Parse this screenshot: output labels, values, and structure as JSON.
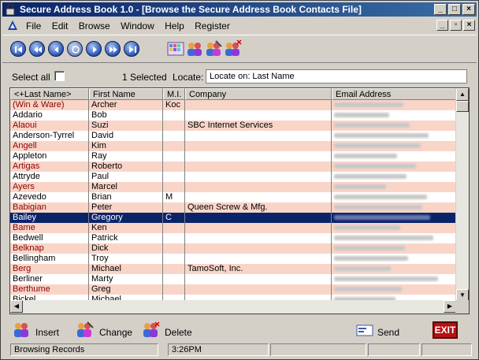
{
  "window": {
    "title": "Secure Address Book 1.0 - [Browse the Secure Address Book Contacts File]",
    "controls": [
      "_",
      "□",
      "×"
    ],
    "mdi_controls": [
      "_",
      "▫",
      "×"
    ]
  },
  "menu": {
    "items": [
      "File",
      "Edit",
      "Browse",
      "Window",
      "Help",
      "Register"
    ]
  },
  "toolbar": {
    "nav_buttons": [
      "first",
      "prev-page",
      "prev",
      "refresh",
      "next",
      "next-page",
      "last"
    ],
    "action_icons": [
      "mosaic-icon",
      "contacts-icon",
      "contacts-edit-icon",
      "contacts-delete-icon"
    ]
  },
  "filter": {
    "select_all_label": "Select all",
    "selected_count": "1 Selected",
    "locate_label": "Locate:",
    "locate_value": "Locate on: Last Name"
  },
  "grid": {
    "columns": [
      "<+Last Name>",
      "First Name",
      "M.I.",
      "Company",
      "Email Address"
    ],
    "rows": [
      {
        "last": "(Win & Ware)",
        "first": "Archer",
        "mi": "Koc",
        "company": "",
        "email_len": 88
      },
      {
        "last": "Addario",
        "first": "Bob",
        "mi": "",
        "company": "",
        "email_len": 70
      },
      {
        "last": "Alaoui",
        "first": "Suzi",
        "mi": "",
        "company": "SBC Internet Services",
        "email_len": 96
      },
      {
        "last": "Anderson-Tyrrel",
        "first": "David",
        "mi": "",
        "company": "",
        "email_len": 120
      },
      {
        "last": "Angell",
        "first": "Kim",
        "mi": "",
        "company": "",
        "email_len": 110
      },
      {
        "last": "Appleton",
        "first": "Ray",
        "mi": "",
        "company": "",
        "email_len": 80
      },
      {
        "last": "Artigas",
        "first": "Roberto",
        "mi": "",
        "company": "",
        "email_len": 104
      },
      {
        "last": "Attryde",
        "first": "Paul",
        "mi": "",
        "company": "",
        "email_len": 92
      },
      {
        "last": "Ayers",
        "first": "Marcel",
        "mi": "",
        "company": "",
        "email_len": 66
      },
      {
        "last": "Azevedo",
        "first": "Brian",
        "mi": "M",
        "company": "",
        "email_len": 118
      },
      {
        "last": "Babigian",
        "first": "Peter",
        "mi": "",
        "company": "Queen Screw & Mfg.",
        "email_len": 112
      },
      {
        "last": "Bailey",
        "first": "Gregory",
        "mi": "C",
        "company": "",
        "email_len": 122,
        "selected": true
      },
      {
        "last": "Bame",
        "first": "Ken",
        "mi": "",
        "company": "",
        "email_len": 84
      },
      {
        "last": "Bedwell",
        "first": "Patrick",
        "mi": "",
        "company": "",
        "email_len": 126
      },
      {
        "last": "Belknap",
        "first": "Dick",
        "mi": "",
        "company": "",
        "email_len": 90
      },
      {
        "last": "Bellingham",
        "first": "Troy",
        "mi": "",
        "company": "",
        "email_len": 94
      },
      {
        "last": "Berg",
        "first": "Michael",
        "mi": "",
        "company": "TamoSoft, Inc.",
        "email_len": 72
      },
      {
        "last": "Berliner",
        "first": "Marty",
        "mi": "",
        "company": "",
        "email_len": 132
      },
      {
        "last": "Berthume",
        "first": "Greg",
        "mi": "",
        "company": "",
        "email_len": 86
      },
      {
        "last": "Bickel",
        "first": "Michael",
        "mi": "",
        "company": "",
        "email_len": 78
      }
    ]
  },
  "actions": {
    "insert_label": "Insert",
    "change_label": "Change",
    "delete_label": "Delete",
    "send_label": "Send",
    "exit_label": "EXIT"
  },
  "status": {
    "mode": "Browsing Records",
    "time": "3:26PM"
  }
}
